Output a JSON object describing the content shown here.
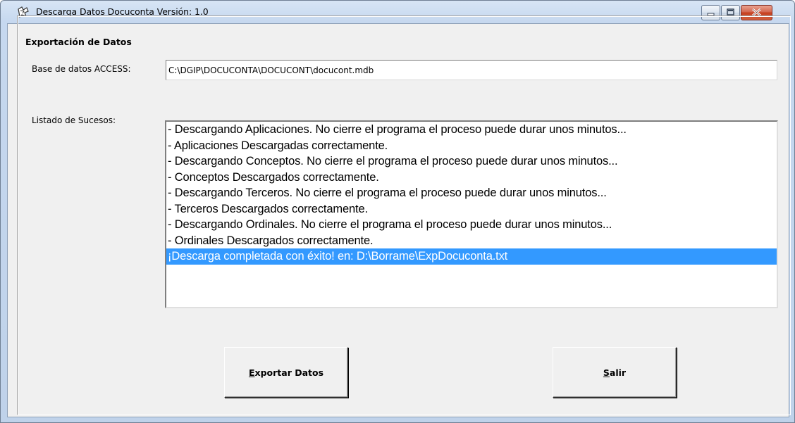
{
  "window": {
    "title": "Descarga Datos Docuconta Versión: 1.0"
  },
  "group": {
    "legend": "Exportación de Datos"
  },
  "database": {
    "label": "Base de datos ACCESS:",
    "value": "C:\\DGIP\\DOCUCONTA\\DOCUCONT\\docucont.mdb"
  },
  "events": {
    "label": "Listado de Sucesos:",
    "items": [
      "- Descargando Aplicaciones. No cierre el programa el proceso puede durar unos minutos...",
      "- Aplicaciones Descargadas correctamente.",
      "- Descargando Conceptos. No cierre el programa el proceso puede durar unos minutos...",
      "- Conceptos Descargados correctamente.",
      "- Descargando Terceros. No cierre el programa el proceso puede durar unos minutos...",
      "- Terceros Descargados correctamente.",
      "- Descargando Ordinales. No cierre el programa el proceso puede durar unos minutos...",
      "- Ordinales Descargados correctamente.",
      "¡Descarga completada con éxito! en: D:\\Borrame\\ExpDocuconta.txt"
    ],
    "selected_index": 8
  },
  "buttons": {
    "export_mnemonic": "E",
    "export_rest": "xportar Datos",
    "exit_mnemonic": "S",
    "exit_rest": "alir"
  },
  "colors": {
    "selection": "#3399ff",
    "close_button": "#c5401f"
  }
}
